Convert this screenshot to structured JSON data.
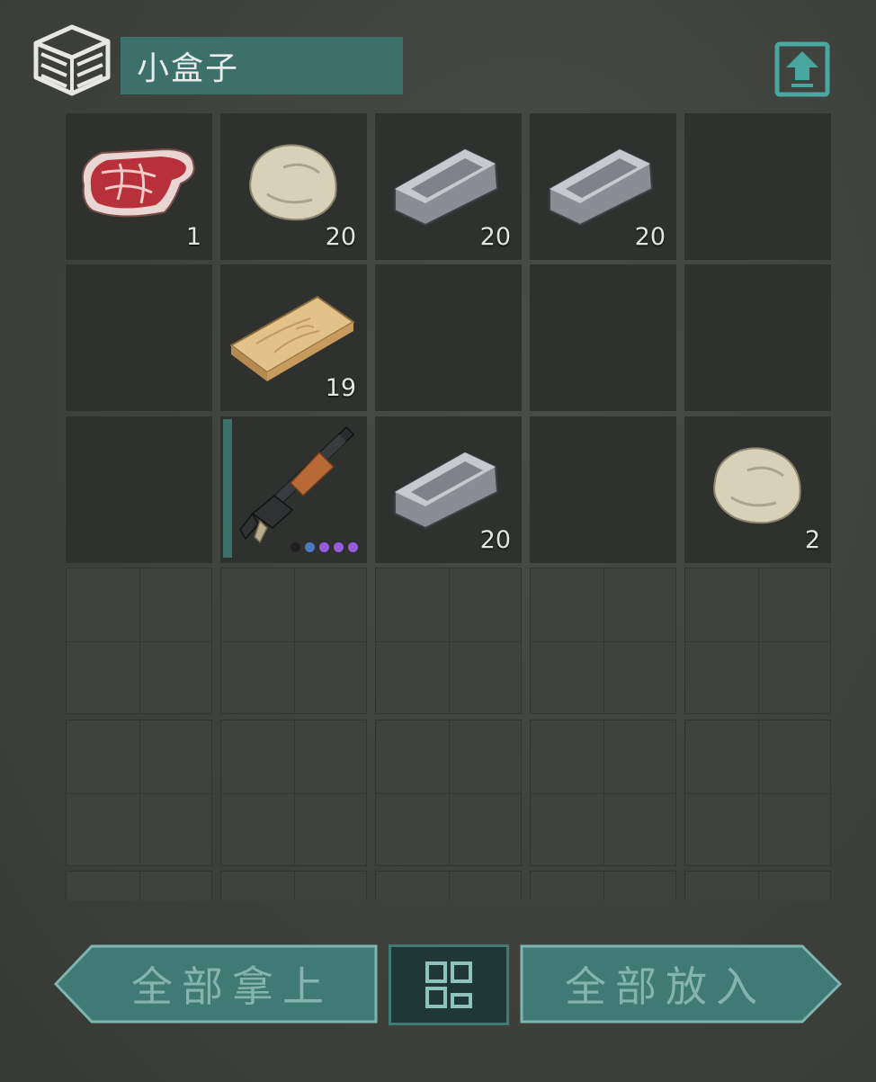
{
  "header": {
    "title": "小盒子",
    "box_icon": "storage-box-icon",
    "upload_icon": "upload-icon"
  },
  "inventory": {
    "slots": [
      {
        "item": "raw-meat",
        "count": "1"
      },
      {
        "item": "stone",
        "count": "20"
      },
      {
        "item": "iron-bar",
        "count": "20"
      },
      {
        "item": "iron-bar",
        "count": "20"
      },
      {
        "item": null,
        "count": ""
      },
      {
        "item": null,
        "count": ""
      },
      {
        "item": "wooden-plank",
        "count": "19"
      },
      {
        "item": null,
        "count": ""
      },
      {
        "item": null,
        "count": ""
      },
      {
        "item": null,
        "count": ""
      },
      {
        "item": null,
        "count": ""
      },
      {
        "item": "pump-shotgun",
        "count": "",
        "upgrade_dots": [
          "#1f1f1f",
          "#4a7bc0",
          "#9a5be0",
          "#9a5be0",
          "#9a5be0"
        ]
      },
      {
        "item": "iron-bar",
        "count": "20"
      },
      {
        "item": null,
        "count": ""
      },
      {
        "item": "stone",
        "count": "2"
      }
    ],
    "locked_rows": 3
  },
  "footer": {
    "take_all_label": "全部拿上",
    "sort_icon": "sort-grid-icon",
    "put_all_label": "全部放入"
  },
  "colors": {
    "accent": "#3d706b",
    "button_text": "#86b3ae",
    "filled_slot": "#2e312d",
    "empty_slot": "#3f423d"
  }
}
